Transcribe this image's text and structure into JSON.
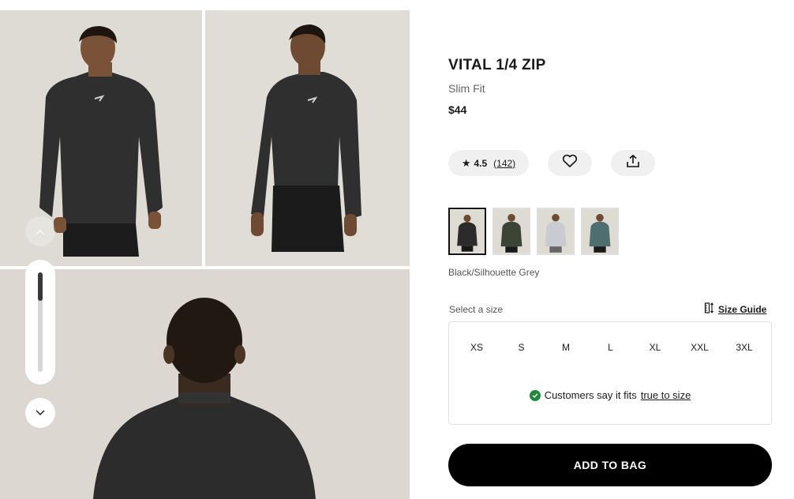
{
  "product": {
    "title": "VITAL 1/4 ZIP",
    "fit": "Slim Fit",
    "price": "$44"
  },
  "rating": {
    "value": "4.5",
    "count": "(142)",
    "star_icon": "star-icon"
  },
  "icons": {
    "wishlist": "heart-icon",
    "share": "share-icon",
    "size_guide": "ruler-icon",
    "nav_up": "chevron-up-icon",
    "nav_down": "chevron-down-icon",
    "check": "check-circle-icon"
  },
  "colours": {
    "selected_name": "Black/Silhouette Grey",
    "swatch_colors": [
      "#2b2b2b",
      "#3c4534",
      "#c8cbd0",
      "#4f6e6f"
    ]
  },
  "sizes": {
    "label": "Select a size",
    "guide_label": "Size Guide",
    "options": [
      "XS",
      "S",
      "M",
      "L",
      "XL",
      "XXL",
      "3XL"
    ],
    "fit_note_prefix": "Customers say it fits",
    "fit_note_link": "true to size"
  },
  "cta": {
    "add_to_bag": "ADD TO BAG"
  },
  "gallery": {
    "scroll_progress": 0.25
  },
  "theme": {
    "accent": "#000000",
    "success": "#1e8a3a",
    "photo_bg": "#dedbd4"
  }
}
